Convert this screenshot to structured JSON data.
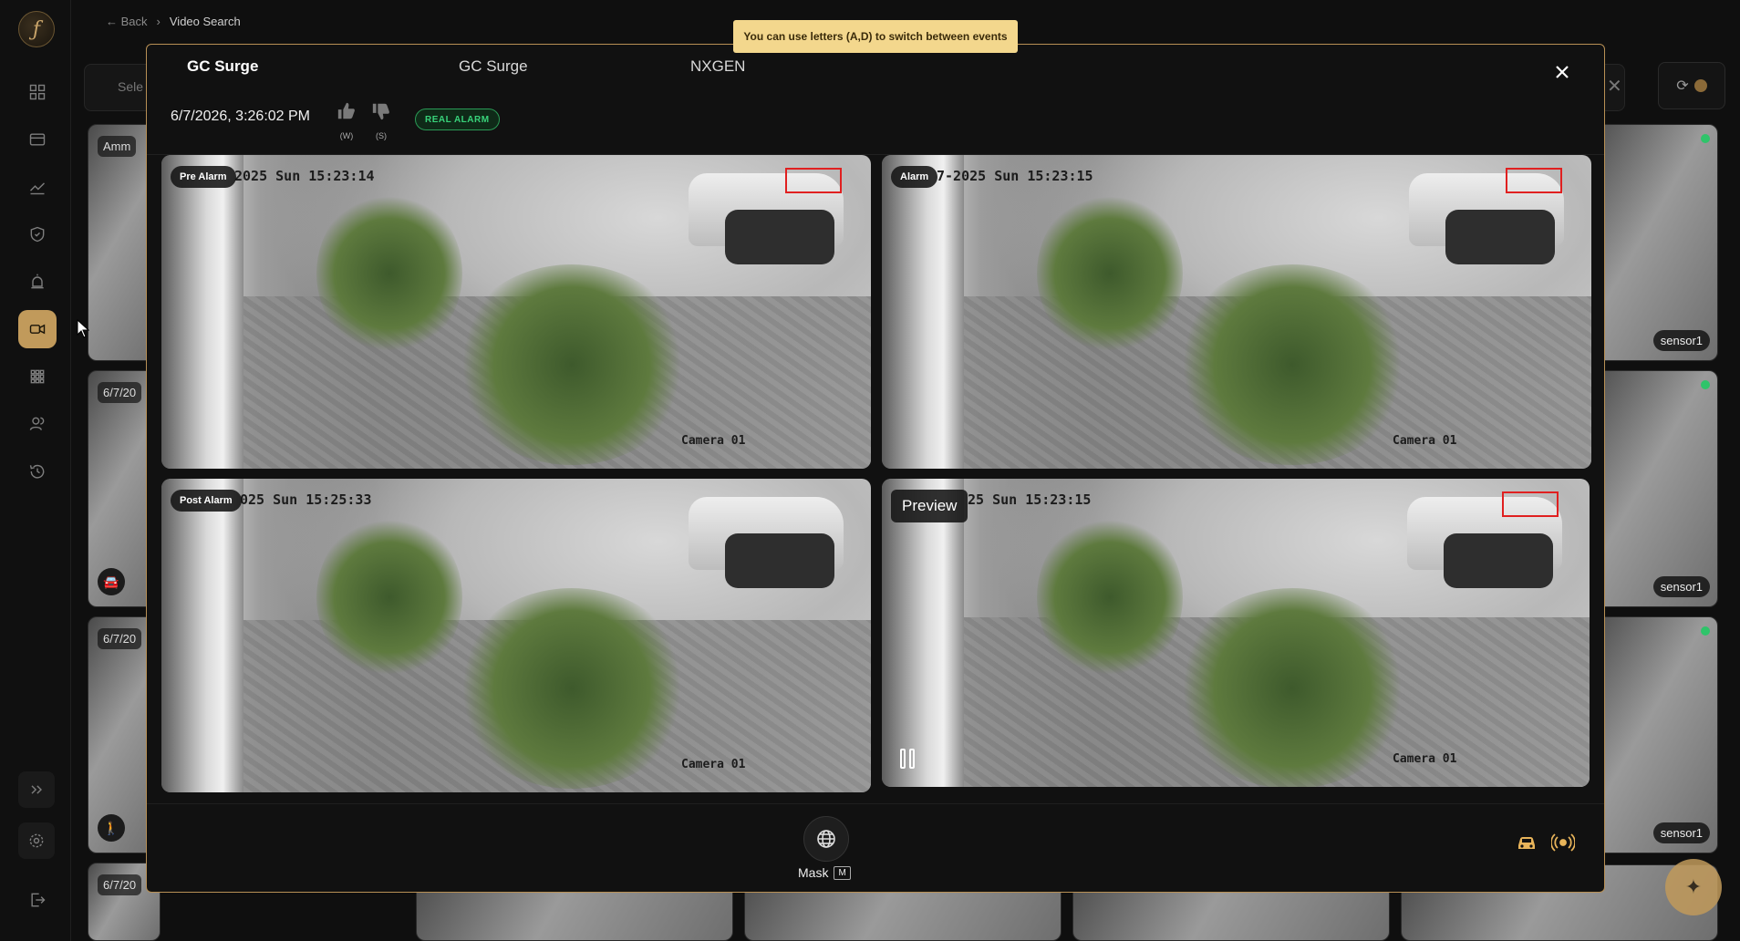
{
  "breadcrumb": {
    "back": "Back",
    "separator": "›",
    "current": "Video Search"
  },
  "background": {
    "search_placeholder": "Sele",
    "cards": [
      {
        "label": "Amm",
        "sensor": "sensor1"
      },
      {
        "label": "6/7/20",
        "sensor": "sensor1"
      },
      {
        "label": "6/7/20",
        "sensor": "sensor1"
      },
      {
        "label": "6/7/20"
      }
    ]
  },
  "hint": {
    "text": "You can use letters (A,D) to switch between events"
  },
  "modal": {
    "tabs": [
      {
        "label": "GC Surge",
        "active": true
      },
      {
        "label": "GC Surge",
        "active": false
      },
      {
        "label": "NXGEN",
        "active": false
      }
    ],
    "timestamp": "6/7/2026, 3:26:02 PM",
    "thumbs_up_key": "(W)",
    "thumbs_down_key": "(S)",
    "badge": "REAL ALARM",
    "tiles": [
      {
        "label": "Pre Alarm",
        "osd_time": "2025 Sun 15:23:14",
        "camera": "Camera 01"
      },
      {
        "label": "Alarm",
        "osd_time": "7-2025 Sun 15:23:15",
        "camera": "Camera 01"
      },
      {
        "label": "Post Alarm",
        "osd_time": "025 Sun 15:25:33",
        "camera": "Camera 01"
      },
      {
        "label": "Preview",
        "osd_time": "25 Sun 15:23:15",
        "camera": "Camera 01"
      }
    ],
    "mask": {
      "label": "Mask",
      "key": "M"
    }
  },
  "colors": {
    "accent": "#c19a5b",
    "badge_green": "#38d27a",
    "hint_bg": "#f3d78d",
    "detection_box": "#e02020"
  }
}
